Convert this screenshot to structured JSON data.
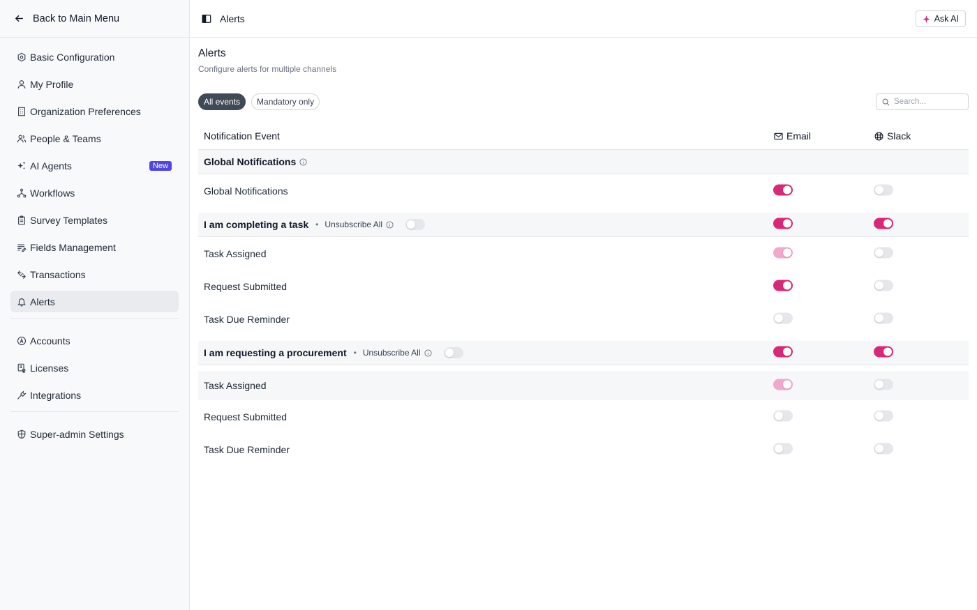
{
  "sidebar": {
    "back_label": "Back to Main Menu",
    "items": [
      {
        "label": "Basic Configuration",
        "icon": "hexagon-icon"
      },
      {
        "label": "My Profile",
        "icon": "user-icon"
      },
      {
        "label": "Organization Preferences",
        "icon": "building-icon"
      },
      {
        "label": "People & Teams",
        "icon": "users-icon"
      },
      {
        "label": "AI Agents",
        "icon": "sparkles-icon",
        "badge": "New"
      },
      {
        "label": "Workflows",
        "icon": "workflow-icon"
      },
      {
        "label": "Survey Templates",
        "icon": "clipboard-icon"
      },
      {
        "label": "Fields Management",
        "icon": "list-edit-icon"
      },
      {
        "label": "Transactions",
        "icon": "arrows-icon"
      },
      {
        "label": "Alerts",
        "icon": "bell-icon",
        "active": true
      }
    ],
    "items2": [
      {
        "label": "Accounts",
        "icon": "circle-a-icon"
      },
      {
        "label": "Licenses",
        "icon": "license-icon"
      },
      {
        "label": "Integrations",
        "icon": "plug-icon"
      }
    ],
    "items3": [
      {
        "label": "Super-admin Settings",
        "icon": "shield-icon"
      }
    ]
  },
  "topbar": {
    "title": "Alerts",
    "ask_ai": "Ask AI"
  },
  "page": {
    "title": "Alerts",
    "subtitle": "Configure alerts for multiple channels",
    "filters": {
      "all": "All events",
      "mandatory": "Mandatory only"
    },
    "search_placeholder": "Search..."
  },
  "table": {
    "header": {
      "event": "Notification Event",
      "email": "Email",
      "slack": "Slack"
    },
    "sections": [
      {
        "title": "Global Notifications",
        "rows": [
          {
            "label": "Global Notifications",
            "email": "on",
            "slack": "off"
          }
        ]
      },
      {
        "title": "I am completing a task",
        "unsubscribe": "Unsubscribe All",
        "group_email": "on",
        "group_slack": "on",
        "rows": [
          {
            "label": "Task Assigned",
            "email": "faded",
            "slack": "off"
          },
          {
            "label": "Request Submitted",
            "email": "on",
            "slack": "off"
          },
          {
            "label": "Task Due Reminder",
            "email": "off",
            "slack": "off"
          }
        ]
      },
      {
        "title": "I am requesting a procurement",
        "unsubscribe": "Unsubscribe All",
        "group_email": "on",
        "group_slack": "on",
        "rows": [
          {
            "label": "Task Assigned",
            "email": "faded",
            "slack": "off"
          },
          {
            "label": "Request Submitted",
            "email": "off",
            "slack": "off"
          },
          {
            "label": "Task Due Reminder",
            "email": "off",
            "slack": "off"
          }
        ]
      }
    ]
  },
  "colors": {
    "accent": "#db2777",
    "accent_faded": "#f4a7cc",
    "badge": "#4f46e5",
    "pill_active": "#3f4a56"
  }
}
